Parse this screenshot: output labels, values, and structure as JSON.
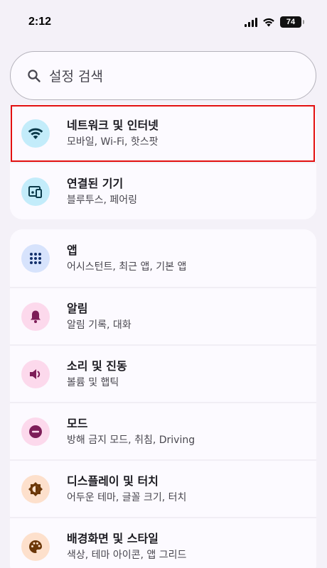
{
  "status": {
    "time": "2:12",
    "battery": "74"
  },
  "search": {
    "placeholder": "설정 검색"
  },
  "groups": [
    {
      "items": [
        {
          "title": "네트워크 및 인터넷",
          "sub": "모바일, Wi-Fi, 핫스팟",
          "icon": "wifi-icon",
          "color": "#c3ecfa"
        },
        {
          "title": "연결된 기기",
          "sub": "블루투스, 페어링",
          "icon": "connected-devices-icon",
          "color": "#c3ecfa"
        }
      ]
    },
    {
      "items": [
        {
          "title": "앱",
          "sub": "어시스턴트, 최근 앱, 기본 앱",
          "icon": "apps-grid-icon",
          "color": "#d7e3fc"
        },
        {
          "title": "알림",
          "sub": "알림 기록, 대화",
          "icon": "bell-icon",
          "color": "#fcd9ec"
        },
        {
          "title": "소리 및 진동",
          "sub": "볼륨 및 햅틱",
          "icon": "volume-icon",
          "color": "#fcd9ec"
        },
        {
          "title": "모드",
          "sub": "방해 금지 모드, 취침, Driving",
          "icon": "do-not-disturb-icon",
          "color": "#fcd9ec"
        },
        {
          "title": "디스플레이 및 터치",
          "sub": "어두운 테마, 글꼴 크기, 터치",
          "icon": "brightness-icon",
          "color": "#fde0cc"
        },
        {
          "title": "배경화면 및 스타일",
          "sub": "색상, 테마 아이콘, 앱 그리드",
          "icon": "palette-icon",
          "color": "#fde0cc"
        }
      ]
    }
  ]
}
